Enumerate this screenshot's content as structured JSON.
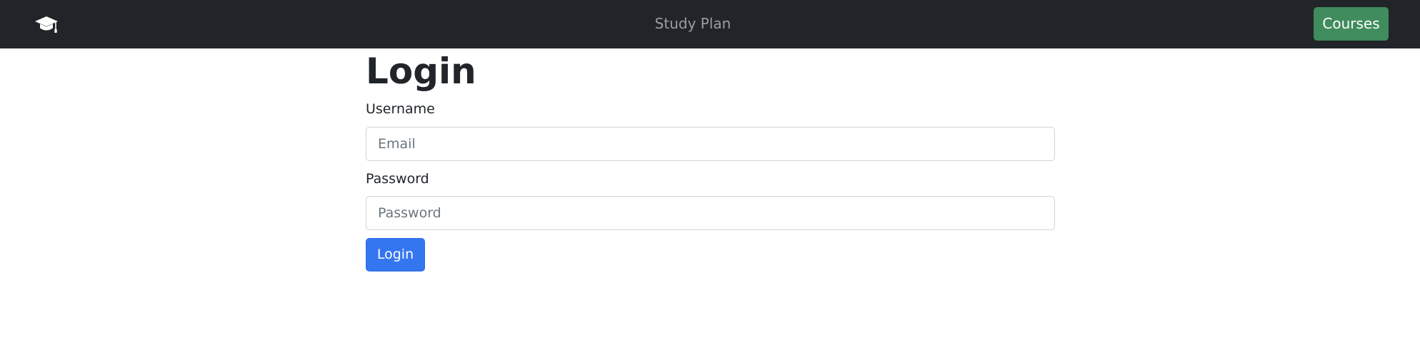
{
  "navbar": {
    "brand_icon": "graduation-cap-icon",
    "title": "Study Plan",
    "courses_label": "Courses",
    "courses_color": "#408c5c",
    "background": "#212529"
  },
  "login_form": {
    "heading": "Login",
    "username_label": "Username",
    "username_placeholder": "Email",
    "username_value": "",
    "password_label": "Password",
    "password_placeholder": "Password",
    "password_value": "",
    "submit_label": "Login",
    "submit_color": "#3475f0"
  }
}
